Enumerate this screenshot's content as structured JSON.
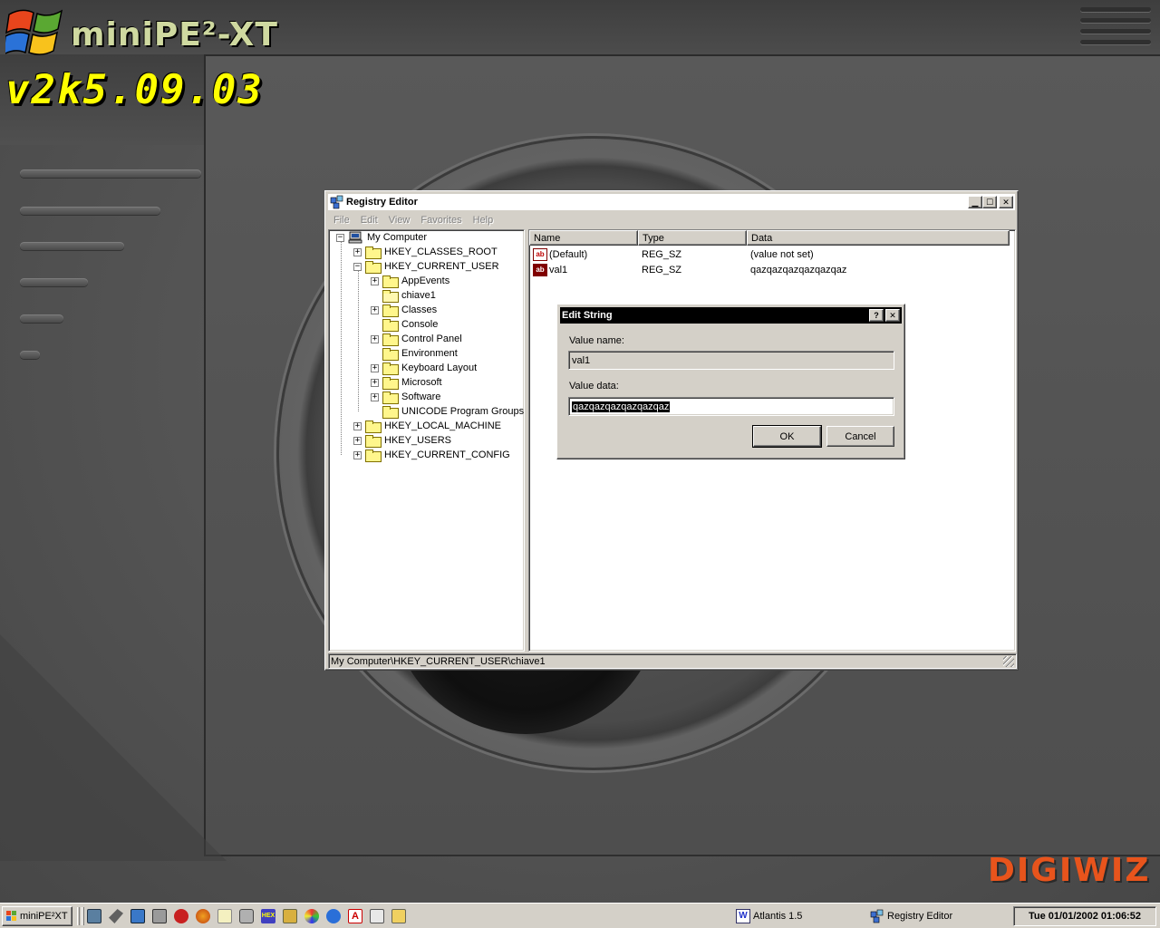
{
  "desktop": {
    "logo_title": "miniPE²-XT",
    "logo_version": "v2k5.09.03",
    "brand": "DIGIWIZ"
  },
  "regedit": {
    "title": "Registry Editor",
    "menu": [
      "File",
      "Edit",
      "View",
      "Favorites",
      "Help"
    ],
    "tree": [
      {
        "label": "My Computer",
        "level": 0,
        "expander": "−",
        "icon": "computer-icon"
      },
      {
        "label": "HKEY_CLASSES_ROOT",
        "level": 1,
        "expander": "+",
        "icon": "folder-icon"
      },
      {
        "label": "HKEY_CURRENT_USER",
        "level": 1,
        "expander": "−",
        "icon": "folder-icon"
      },
      {
        "label": "AppEvents",
        "level": 2,
        "expander": "+",
        "icon": "folder-icon"
      },
      {
        "label": "chiave1",
        "level": 2,
        "expander": "",
        "icon": "open-folder-icon"
      },
      {
        "label": "Classes",
        "level": 2,
        "expander": "+",
        "icon": "folder-icon"
      },
      {
        "label": "Console",
        "level": 2,
        "expander": "",
        "icon": "folder-icon"
      },
      {
        "label": "Control Panel",
        "level": 2,
        "expander": "+",
        "icon": "folder-icon"
      },
      {
        "label": "Environment",
        "level": 2,
        "expander": "",
        "icon": "folder-icon"
      },
      {
        "label": "Keyboard Layout",
        "level": 2,
        "expander": "+",
        "icon": "folder-icon"
      },
      {
        "label": "Microsoft",
        "level": 2,
        "expander": "+",
        "icon": "folder-icon"
      },
      {
        "label": "Software",
        "level": 2,
        "expander": "+",
        "icon": "folder-icon"
      },
      {
        "label": "UNICODE Program Groups",
        "level": 2,
        "expander": "",
        "icon": "folder-icon"
      },
      {
        "label": "HKEY_LOCAL_MACHINE",
        "level": 1,
        "expander": "+",
        "icon": "folder-icon"
      },
      {
        "label": "HKEY_USERS",
        "level": 1,
        "expander": "+",
        "icon": "folder-icon"
      },
      {
        "label": "HKEY_CURRENT_CONFIG",
        "level": 1,
        "expander": "+",
        "icon": "folder-icon"
      }
    ],
    "columns": [
      "Name",
      "Type",
      "Data"
    ],
    "values": [
      {
        "name": "(Default)",
        "type": "REG_SZ",
        "data": "(value not set)",
        "icon": "string-value-icon"
      },
      {
        "name": "val1",
        "type": "REG_SZ",
        "data": "qazqazqazqazqazqaz",
        "icon": "string-value-icon"
      }
    ],
    "status": "My Computer\\HKEY_CURRENT_USER\\chiave1"
  },
  "dialog": {
    "title": "Edit String",
    "help_glyph": "?",
    "close_glyph": "✕",
    "value_name_label": "Value name:",
    "value_name": "val1",
    "value_data_label": "Value data:",
    "value_data": "qazqazqazqazqazqaz",
    "ok": "OK",
    "cancel": "Cancel"
  },
  "taskbar": {
    "start_label": "miniPE²XT",
    "quicklaunch": [
      "system-icon",
      "tools-icon",
      "network-icon",
      "pc-icon",
      "antivirus-icon",
      "firefox-icon",
      "notepad-icon",
      "disk-icon",
      "hex-editor-icon",
      "archive-icon",
      "paint-icon",
      "ie-icon",
      "acrobat-icon",
      "explorer-icon",
      "installer-icon"
    ],
    "tasks": [
      {
        "label": "Atlantis 1.5",
        "icon": "word-processor-icon"
      },
      {
        "label": "Registry Editor",
        "icon": "regedit-icon"
      }
    ],
    "clock": "Tue 01/01/2002 01:06:52"
  },
  "colors": {
    "window_bg": "#d4d0c8",
    "dialog_title_bg": "#000000",
    "brand": "#e8541c",
    "logo_version": "#ffff00"
  }
}
